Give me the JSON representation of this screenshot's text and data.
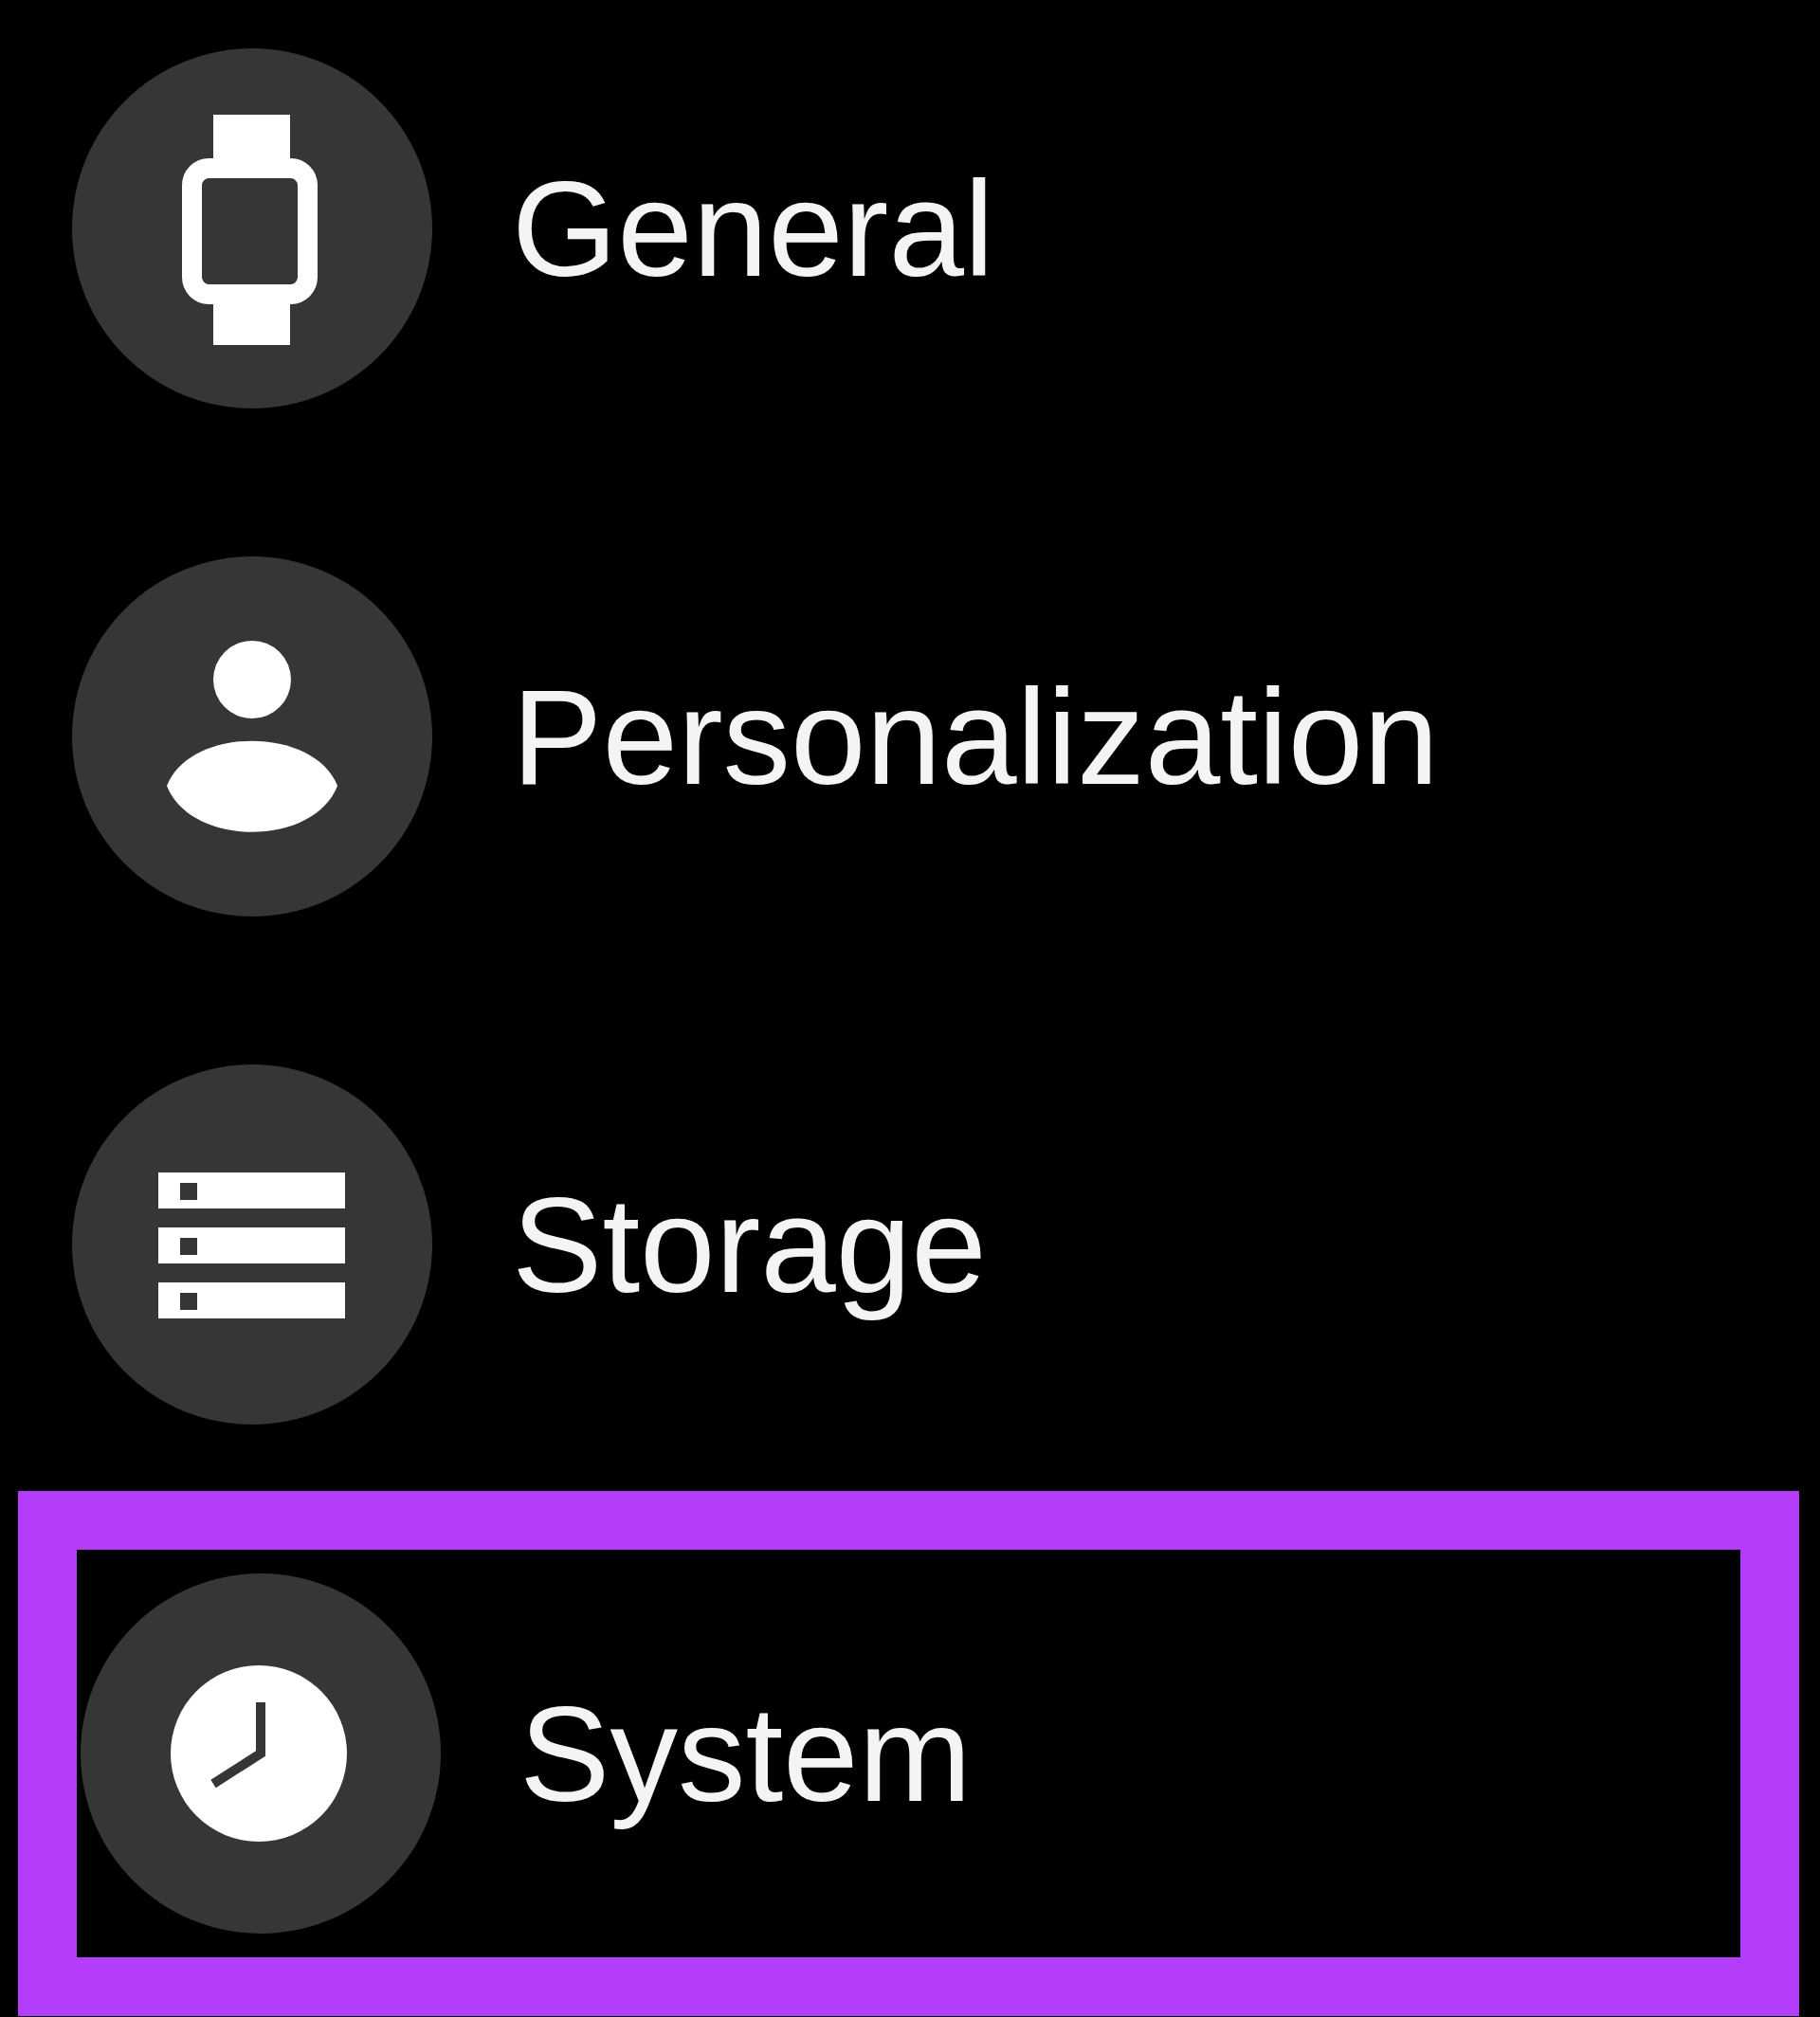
{
  "menu": {
    "items": [
      {
        "label": "General",
        "selected": false
      },
      {
        "label": "Personalization",
        "selected": false
      },
      {
        "label": "Storage",
        "selected": false
      },
      {
        "label": "System",
        "selected": true
      }
    ]
  }
}
